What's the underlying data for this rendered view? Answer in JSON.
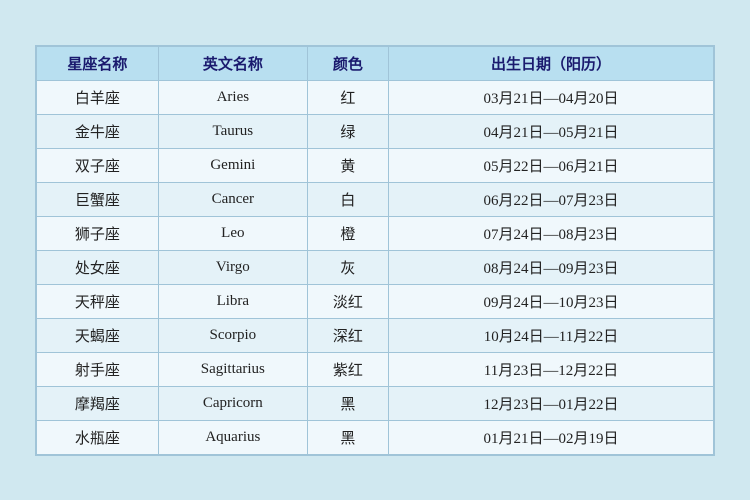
{
  "table": {
    "headers": {
      "zh_name": "星座名称",
      "en_name": "英文名称",
      "color": "颜色",
      "date_range": "出生日期（阳历）"
    },
    "rows": [
      {
        "zh": "白羊座",
        "en": "Aries",
        "color": "红",
        "date": "03月21日—04月20日"
      },
      {
        "zh": "金牛座",
        "en": "Taurus",
        "color": "绿",
        "date": "04月21日—05月21日"
      },
      {
        "zh": "双子座",
        "en": "Gemini",
        "color": "黄",
        "date": "05月22日—06月21日"
      },
      {
        "zh": "巨蟹座",
        "en": "Cancer",
        "color": "白",
        "date": "06月22日—07月23日"
      },
      {
        "zh": "狮子座",
        "en": "Leo",
        "color": "橙",
        "date": "07月24日—08月23日"
      },
      {
        "zh": "处女座",
        "en": "Virgo",
        "color": "灰",
        "date": "08月24日—09月23日"
      },
      {
        "zh": "天秤座",
        "en": "Libra",
        "color": "淡红",
        "date": "09月24日—10月23日"
      },
      {
        "zh": "天蝎座",
        "en": "Scorpio",
        "color": "深红",
        "date": "10月24日—11月22日"
      },
      {
        "zh": "射手座",
        "en": "Sagittarius",
        "color": "紫红",
        "date": "11月23日—12月22日"
      },
      {
        "zh": "摩羯座",
        "en": "Capricorn",
        "color": "黑",
        "date": "12月23日—01月22日"
      },
      {
        "zh": "水瓶座",
        "en": "Aquarius",
        "color": "黑",
        "date": "01月21日—02月19日"
      }
    ]
  }
}
